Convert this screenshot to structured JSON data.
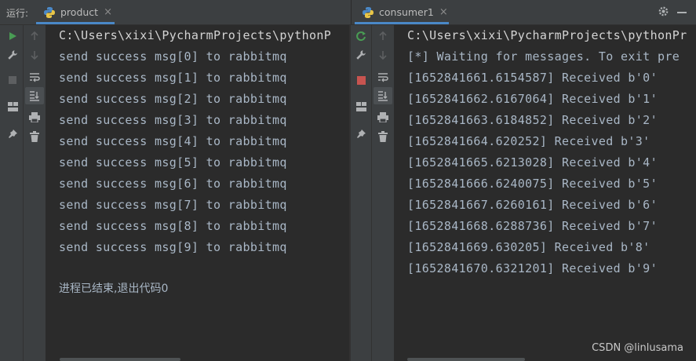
{
  "header": {
    "run_label": "运行:",
    "tabs": [
      {
        "label": "product",
        "close": "×"
      },
      {
        "label": "consumer1",
        "close": "×"
      }
    ],
    "settings_icon": "gear-icon",
    "minimize_icon": "minimize-icon"
  },
  "left_console": {
    "command": "C:\\Users\\xixi\\PycharmProjects\\pythonP",
    "lines": [
      "send success msg[0] to rabbitmq",
      "send success msg[1] to rabbitmq",
      "send success msg[2] to rabbitmq",
      "send success msg[3] to rabbitmq",
      "send success msg[4] to rabbitmq",
      "send success msg[5] to rabbitmq",
      "send success msg[6] to rabbitmq",
      "send success msg[7] to rabbitmq",
      "send success msg[8] to rabbitmq",
      "send success msg[9] to rabbitmq"
    ],
    "exit_message": "进程已结束,退出代码0"
  },
  "right_console": {
    "command": "C:\\Users\\xixi\\PycharmProjects\\pythonPr",
    "waiting": "[*] Waiting for messages. To exit pre",
    "lines": [
      "[1652841661.6154587] Received b'0'",
      "[1652841662.6167064] Received b'1'",
      "[1652841663.6184852] Received b'2'",
      "[1652841664.620252] Received b'3'",
      "[1652841665.6213028] Received b'4'",
      "[1652841666.6240075] Received b'5'",
      "[1652841667.6260161] Received b'6'",
      "[1652841668.6288736] Received b'7'",
      "[1652841669.630205] Received b'8'",
      "[1652841670.6321201] Received b'9'"
    ]
  },
  "watermark": "CSDN @linlusama",
  "colors": {
    "background": "#2b2b2b",
    "toolbar": "#3c3f41",
    "text": "#a9b7c6",
    "run_green": "#499c54",
    "stop_red": "#c75450",
    "tab_underline": "#4a88c7"
  }
}
